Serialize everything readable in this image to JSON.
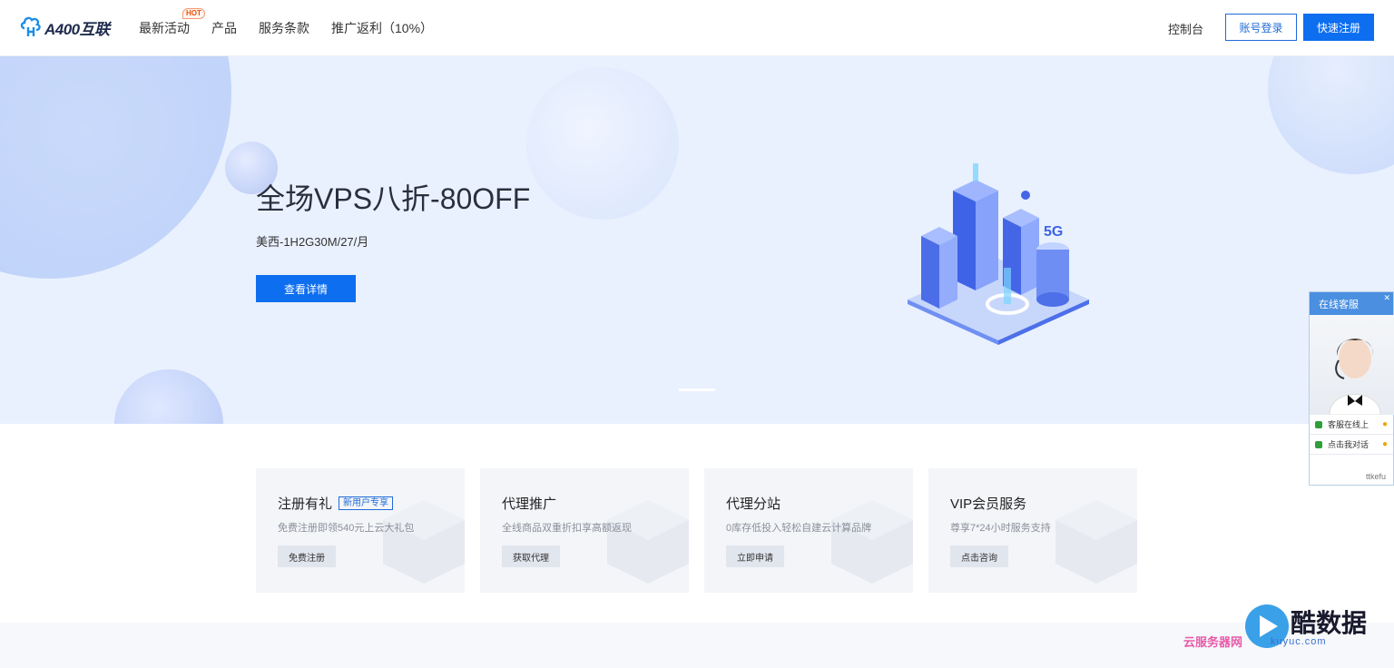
{
  "header": {
    "logo_text": "A400互联",
    "nav": [
      {
        "label": "最新活动",
        "badge": "HOT"
      },
      {
        "label": "产品"
      },
      {
        "label": "服务条款"
      },
      {
        "label": "推广返利（10%）"
      }
    ],
    "console_label": "控制台",
    "login_label": "账号登录",
    "register_label": "快速注册"
  },
  "banner": {
    "title": "全场VPS八折-80OFF",
    "subtitle": "美西-1H2G30M/27/月",
    "button_label": "查看详情",
    "illustration_text": "5G"
  },
  "cards": [
    {
      "title": "注册有礼",
      "badge": "新用户专享",
      "desc": "免费注册即领540元上云大礼包",
      "button": "免费注册"
    },
    {
      "title": "代理推广",
      "badge": "",
      "desc": "全线商品双重折扣享高额返现",
      "button": "获取代理"
    },
    {
      "title": "代理分站",
      "badge": "",
      "desc": "0库存低投入轻松自建云计算品牌",
      "button": "立即申请"
    },
    {
      "title": "VIP会员服务",
      "badge": "",
      "desc": "尊享7*24小时服务支持",
      "button": "点击咨询"
    }
  ],
  "chat": {
    "title": "在线客服",
    "rows": [
      "客服在线上",
      "点击我对话"
    ],
    "footer": "ttkefu"
  },
  "watermark": {
    "brand": "酷数据",
    "sub": "云服务器网",
    "url": "kuyuc.com"
  },
  "colors": {
    "primary": "#0d6ef0",
    "banner_bg": "#e9f1fe",
    "card_bg": "#f3f5f9"
  }
}
